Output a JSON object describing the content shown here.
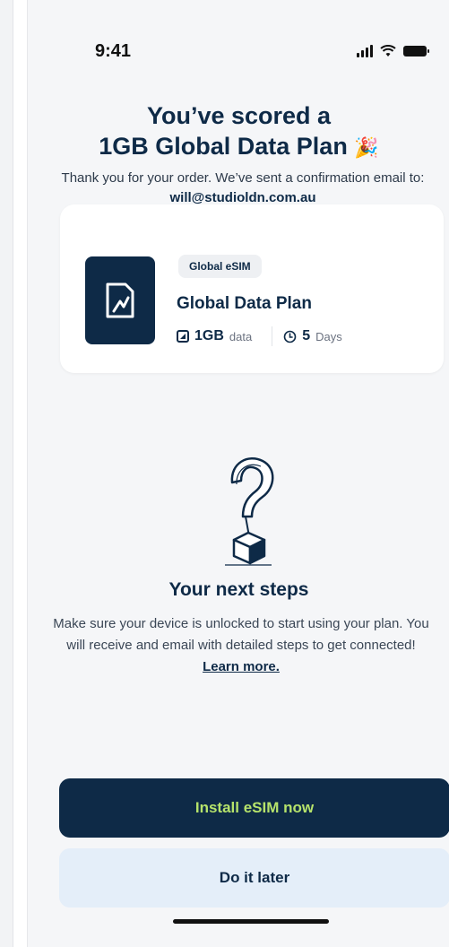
{
  "status_bar": {
    "time": "9:41"
  },
  "header": {
    "title_line1": "You’ve scored a",
    "title_line2": "1GB Global Data Plan",
    "title_emoji": "🎉",
    "subtitle_text": "Thank you for your order. We’ve sent a confirmation email to:",
    "subtitle_email": "will@studioldn.com.au"
  },
  "plan": {
    "badge": "Global eSIM",
    "name": "Global Data Plan",
    "data_amount": "1GB",
    "data_unit": "data",
    "days_amount": "5",
    "days_unit": "Days"
  },
  "next_steps": {
    "title": "Your next steps",
    "body": "Make sure your device is unlocked to start using your plan. You will receive and email with detailed steps to get connected!",
    "link": "Learn more."
  },
  "actions": {
    "primary_label": "Install eSIM now",
    "secondary_label": "Do it later"
  },
  "colors": {
    "brand_navy": "#0e2a47",
    "accent_green": "#b6e36b",
    "secondary_bg": "#e4eef9"
  }
}
